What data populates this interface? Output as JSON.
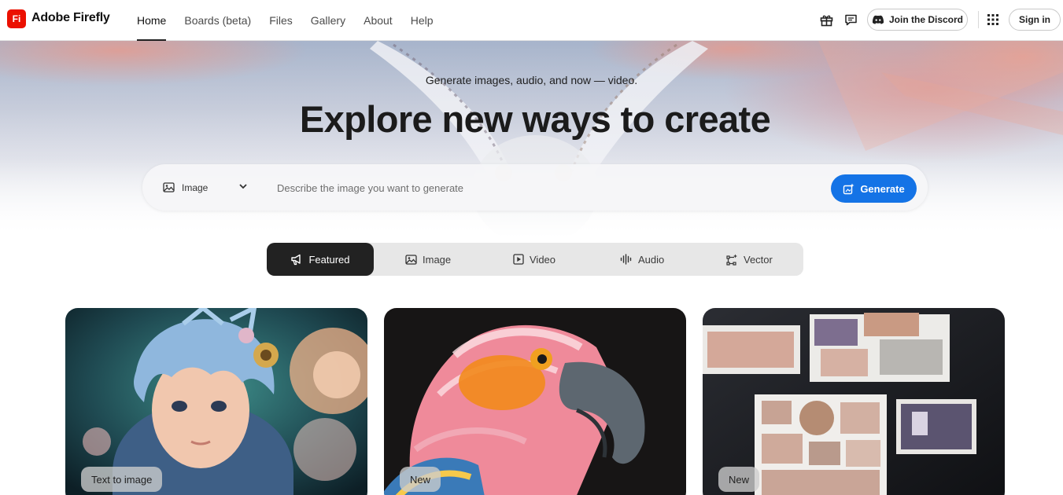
{
  "brand": {
    "logo_text": "Fi",
    "name": "Adobe Firefly",
    "color": "#eb1000"
  },
  "nav": {
    "items": [
      {
        "label": "Home",
        "active": true
      },
      {
        "label": "Boards (beta)",
        "active": false
      },
      {
        "label": "Files",
        "active": false
      },
      {
        "label": "Gallery",
        "active": false
      },
      {
        "label": "About",
        "active": false
      },
      {
        "label": "Help",
        "active": false
      }
    ]
  },
  "header_actions": {
    "icons": [
      "gift-icon",
      "chat-icon",
      "app-grid-icon"
    ],
    "discord_label": "Join the Discord",
    "signin_label": "Sign in"
  },
  "hero": {
    "subtitle": "Generate images, audio, and now — video.",
    "title": "Explore new ways to create"
  },
  "search": {
    "mode_label": "Image",
    "placeholder": "Describe the image you want to generate",
    "value": "",
    "generate_label": "Generate",
    "accent": "#1473e6"
  },
  "category_tabs": [
    {
      "label": "Featured",
      "icon": "megaphone-icon",
      "active": true
    },
    {
      "label": "Image",
      "icon": "image-icon",
      "active": false
    },
    {
      "label": "Video",
      "icon": "video-icon",
      "active": false
    },
    {
      "label": "Audio",
      "icon": "audio-wave-icon",
      "active": false
    },
    {
      "label": "Vector",
      "icon": "vector-icon",
      "active": false
    }
  ],
  "cards": [
    {
      "badge": "Text to image",
      "subject": "blue-haired-child-with-flowers"
    },
    {
      "badge": "New",
      "subject": "parrot-closeup"
    },
    {
      "badge": "New",
      "subject": "moodboard-collage"
    }
  ]
}
